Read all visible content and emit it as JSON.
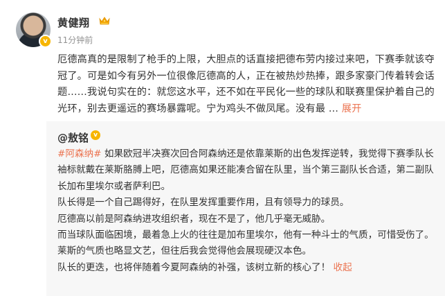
{
  "post": {
    "author_name": "黄健翔",
    "time": "11分钟前",
    "body_text": "厄德高真的是限制了枪手的上限，大胆点的话直接把德布劳内接过来吧，下赛季就该夺冠了。可是如今有另外一位很像厄德高的人，正在被热炒热捧，跟多家豪门传着转会话题……我说句实在的：就您这水平，还不如在平民化一些的球队和联赛里保护着自己的光环，别去更遥远的赛场暴露呢。宁为鸡头不做凤尾。没有最 … ",
    "expand_label": "展开"
  },
  "repost": {
    "author": "@敖铭",
    "hashtag": "#阿森纳#",
    "paragraph1": " 如果欧冠半决赛次回合阿森纳还是依靠莱斯的出色发挥逆转，我觉得下赛季队长袖标就戴在莱斯胳膊上吧，厄德高如果还能凑合留在队里，当个第三副队长合适，第二副队长加布里埃尔或者萨利巴。",
    "paragraph2": "队长得是一个自己踢得好，在队里发挥重要作用，且有领导力的球员。",
    "paragraph3": "厄德高以前是阿森纳进攻组织者，现在不是了，他几乎毫无威胁。",
    "paragraph4": "而当球队面临困境，最着急上火的往往是加布里埃尔，他有一种斗士的气质，可惜受伤了。",
    "paragraph5": "莱斯的气质也略显文艺，但往后我会觉得他会展现硬汉本色。",
    "paragraph6": "队长的更迭，也将伴随着今夏阿森纳的补强，该树立新的核心了！",
    "collapse_label": "收起"
  },
  "icons": {
    "verified": "verified-badge-icon",
    "vip": "vip-crown-icon",
    "gold_v": "gold-v-icon"
  },
  "colors": {
    "link": "#eb7350",
    "badge": "#f7b500",
    "repost_bg": "#f7f7f7",
    "muted": "#939393"
  }
}
